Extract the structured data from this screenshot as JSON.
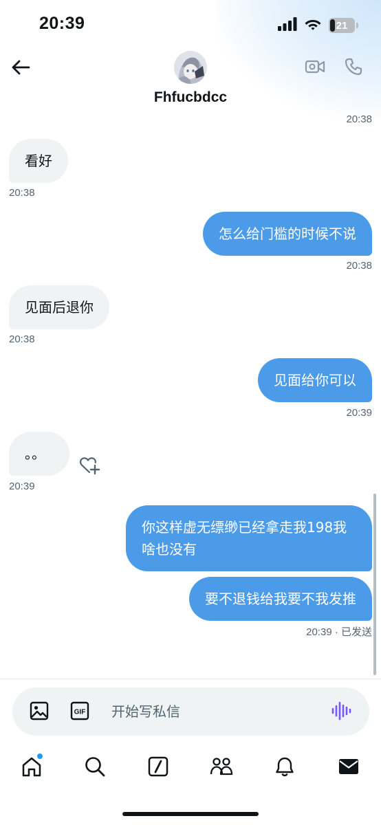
{
  "status_bar": {
    "time": "20:39",
    "battery": "21",
    "battery_level": 0.21
  },
  "header": {
    "contact_name": "Fhfucbdcc"
  },
  "conversation": {
    "top_timestamp": "20:38",
    "messages": [
      {
        "direction": "in",
        "text": "看好",
        "time": "20:38"
      },
      {
        "direction": "out",
        "text": "怎么给门槛的时候不说",
        "time": "20:38"
      },
      {
        "direction": "in",
        "text": "见面后退你",
        "time": "20:38"
      },
      {
        "direction": "out",
        "text": "见面给你可以",
        "time": "20:39"
      },
      {
        "direction": "in",
        "text": "。。",
        "time": "20:39"
      },
      {
        "direction": "out",
        "text": "你这样虚无缥缈已经拿走我198我啥也没有",
        "line1": "你这样虚无缥缈已经拿走我198我",
        "line2": "啥也没有"
      },
      {
        "direction": "out",
        "text": "要不退钱给我要不我发推",
        "time": "20:39 · 已发送"
      }
    ]
  },
  "composer": {
    "placeholder": "开始写私信"
  },
  "icons": {
    "back": "arrow-left-icon",
    "video": "video-call-icon",
    "phone": "phone-icon",
    "react": "heart-plus-icon",
    "image": "image-icon",
    "gif": "gif-icon",
    "voice": "voice-wave-icon",
    "home": "home-icon",
    "search": "search-icon",
    "grok": "grok-icon",
    "communities": "communities-icon",
    "notifications": "bell-icon",
    "messages": "mail-icon"
  },
  "colors": {
    "outgoing_bubble": "#4c9be8",
    "incoming_bubble": "#eff3f4",
    "accent": "#1d9bf0",
    "voice": "#7856ff"
  }
}
